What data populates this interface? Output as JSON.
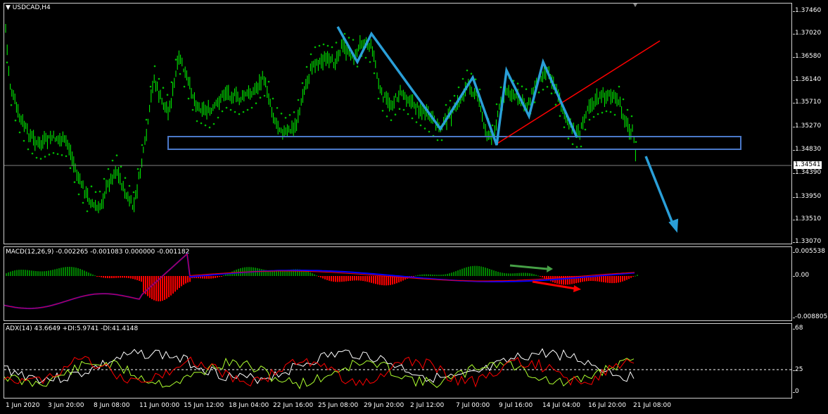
{
  "chart": {
    "symbol_label": "USDCAD,H4",
    "price_ticks": [
      "1.37460",
      "1.37020",
      "1.36580",
      "1.36140",
      "1.35710",
      "1.35270",
      "1.34830",
      "1.34390",
      "1.33950",
      "1.33510",
      "1.33070"
    ],
    "current_price": "1.34541",
    "time_ticks": [
      "1 Jun 2020",
      "3 Jun 20:00",
      "8 Jun 08:00",
      "11 Jun 00:00",
      "15 Jun 12:00",
      "18 Jun 04:00",
      "22 Jun 16:00",
      "25 Jun 08:00",
      "29 Jun 20:00",
      "2 Jul 12:00",
      "7 Jul 00:00",
      "9 Jul 16:00",
      "14 Jul 04:00",
      "16 Jul 20:00",
      "21 Jul 08:00"
    ],
    "colors": {
      "candle": "#00ff00",
      "psar": "#00c000",
      "annotation_blue": "#2a9fd8",
      "trendline_red": "#ff0000",
      "box": "#4a78c8"
    }
  },
  "macd": {
    "label": "MACD(12,26,9) -0.002265 -0.001083 0.000000 -0.001182",
    "ticks": [
      "0.005538",
      "0.00",
      "-0.008805"
    ],
    "colors": {
      "pos": "#008000",
      "neg": "#ff0000",
      "main": "#0000ff",
      "signal": "#ff0000",
      "arrow_green": "#46a046",
      "arrow_red": "#ff0000"
    }
  },
  "adx": {
    "label": "ADX(14) 43.6649 +DI:5.9741 -DI:41.4148",
    "ticks": [
      "68",
      "25",
      "0"
    ],
    "colors": {
      "adx": "#ffffff",
      "plus_di": "#adff2f",
      "minus_di": "#ff0000"
    }
  }
}
